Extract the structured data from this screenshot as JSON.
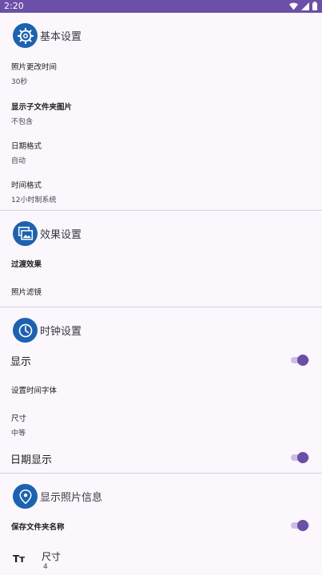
{
  "status_bar": {
    "time": "2:20"
  },
  "sections": {
    "basic": {
      "title": "基本设置",
      "photo_interval": {
        "title": "照片更改时间",
        "value": "30秒"
      },
      "subfolder": {
        "title": "显示子文件夹图片",
        "value": "不包含"
      },
      "date_format": {
        "title": "日期格式",
        "value": "自动"
      },
      "time_format": {
        "title": "时间格式",
        "value": "12小时制系统"
      }
    },
    "effects": {
      "title": "效果设置",
      "transition": {
        "title": "过渡效果"
      },
      "filter": {
        "title": "照片滤镜"
      }
    },
    "clock": {
      "title": "时钟设置",
      "display": {
        "label": "显示",
        "enabled": true
      },
      "font": {
        "title": "设置时间字体"
      },
      "size": {
        "title": "尺寸",
        "value": "中等"
      },
      "date_display": {
        "label": "日期显示",
        "enabled": true
      }
    },
    "photo_info": {
      "title": "显示照片信息",
      "save_folder": {
        "title": "保存文件夹名称",
        "enabled": true
      },
      "size": {
        "icon_text": "Tт",
        "title": "尺寸",
        "value": "4"
      }
    }
  },
  "colors": {
    "accent": "#6a4fa5",
    "status_bar": "#6c4fa6",
    "section_badge": "#1d62b0",
    "background": "#fbf7fd"
  },
  "icons": [
    "gear-icon",
    "gallery-icon",
    "clock-icon",
    "location-pin-icon",
    "text-size-icon",
    "wifi-icon",
    "signal-icon",
    "battery-icon"
  ]
}
